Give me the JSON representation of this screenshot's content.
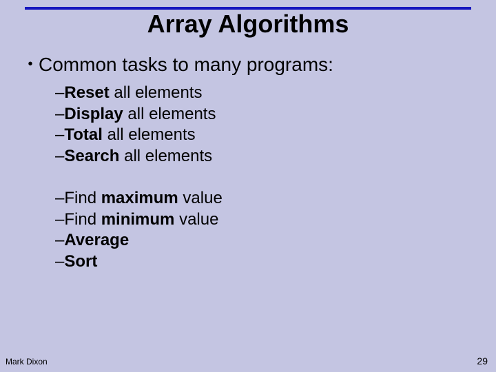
{
  "title": "Array Algorithms",
  "main_bullet": "Common tasks to many programs:",
  "group1": [
    {
      "bold": "Reset",
      "rest": " all elements"
    },
    {
      "bold": "Display",
      "rest": " all elements"
    },
    {
      "bold": "Total",
      "rest": " all elements"
    },
    {
      "bold": "Search",
      "rest": " all elements"
    }
  ],
  "group2": [
    {
      "pre": "Find ",
      "bold": "maximum",
      "rest": " value"
    },
    {
      "pre": "Find ",
      "bold": "minimum",
      "rest": " value"
    },
    {
      "pre": "",
      "bold": "Average",
      "rest": ""
    },
    {
      "pre": "",
      "bold": "Sort",
      "rest": ""
    }
  ],
  "footer_author": "Mark Dixon",
  "footer_page": "29"
}
